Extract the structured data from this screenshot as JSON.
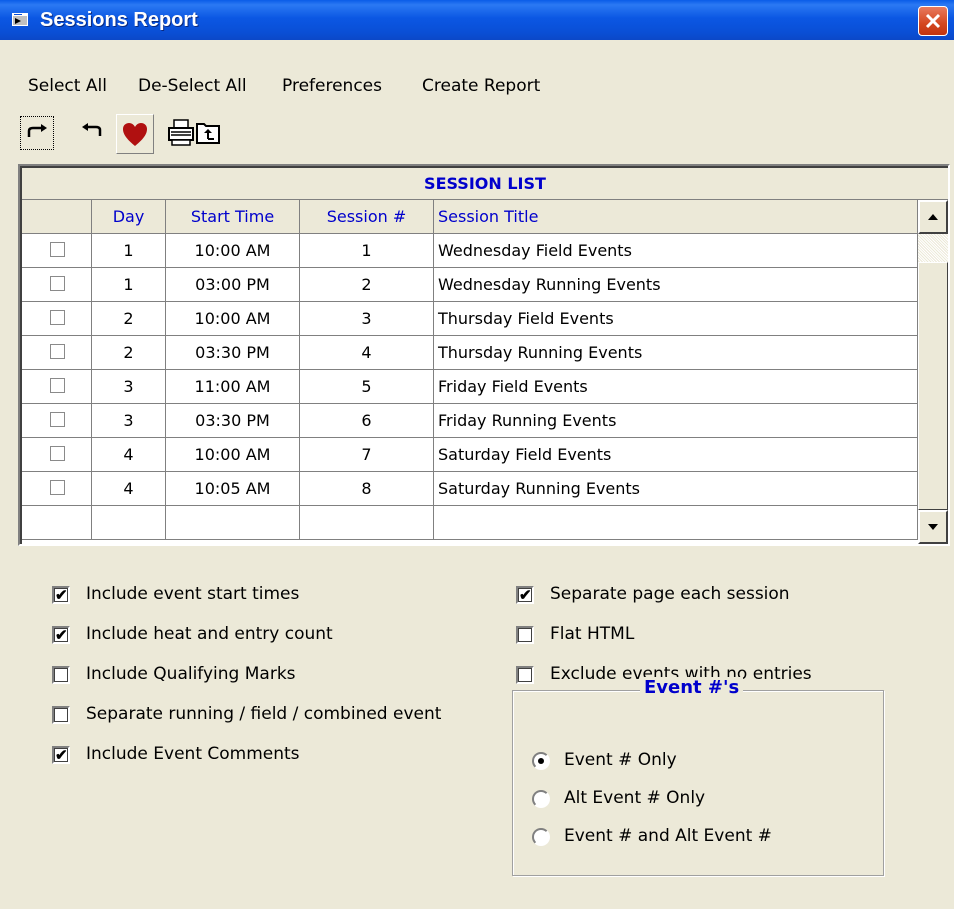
{
  "window": {
    "title": "Sessions Report"
  },
  "menu": [
    "Select All",
    "De-Select All",
    "Preferences",
    "Create Report"
  ],
  "toolbar": [
    {
      "icon": "redo-icon"
    },
    {
      "icon": "undo-icon"
    },
    {
      "icon": "heart-icon"
    },
    {
      "icon": "printer-icon"
    },
    {
      "icon": "export-icon"
    }
  ],
  "grid": {
    "heading": "SESSION LIST",
    "columns": [
      "Day",
      "Start Time",
      "Session #",
      "Session Title"
    ],
    "rows": [
      {
        "checked": false,
        "day": "1",
        "start": "10:00 AM",
        "session": "1",
        "title": "Wednesday Field Events"
      },
      {
        "checked": false,
        "day": "1",
        "start": "03:00 PM",
        "session": "2",
        "title": "Wednesday Running Events"
      },
      {
        "checked": false,
        "day": "2",
        "start": "10:00 AM",
        "session": "3",
        "title": "Thursday Field Events"
      },
      {
        "checked": false,
        "day": "2",
        "start": "03:30 PM",
        "session": "4",
        "title": "Thursday Running Events"
      },
      {
        "checked": false,
        "day": "3",
        "start": "11:00 AM",
        "session": "5",
        "title": "Friday Field Events"
      },
      {
        "checked": false,
        "day": "3",
        "start": "03:30 PM",
        "session": "6",
        "title": "Friday Running Events"
      },
      {
        "checked": false,
        "day": "4",
        "start": "10:00 AM",
        "session": "7",
        "title": "Saturday Field Events"
      },
      {
        "checked": false,
        "day": "4",
        "start": "10:05 AM",
        "session": "8",
        "title": "Saturday Running Events"
      }
    ]
  },
  "options_left": [
    {
      "label": "Include event start times",
      "checked": true
    },
    {
      "label": "Include heat and entry count",
      "checked": true
    },
    {
      "label": "Include Qualifying Marks",
      "checked": false
    },
    {
      "label": "Separate running / field / combined event",
      "checked": false
    },
    {
      "label": "Include Event Comments",
      "checked": true
    }
  ],
  "options_right": [
    {
      "label": "Separate page each session",
      "checked": true
    },
    {
      "label": "Flat HTML",
      "checked": false
    },
    {
      "label": "Exclude events with no entries",
      "checked": false
    }
  ],
  "event_group": {
    "title": "Event #'s",
    "options": [
      {
        "label": "Event # Only",
        "selected": true
      },
      {
        "label": "Alt Event # Only",
        "selected": false
      },
      {
        "label": "Event # and Alt Event #",
        "selected": false
      }
    ]
  },
  "colors": {
    "titlebar": "#0a4fd6",
    "header_text": "#0000cc",
    "face": "#ece9d8"
  }
}
